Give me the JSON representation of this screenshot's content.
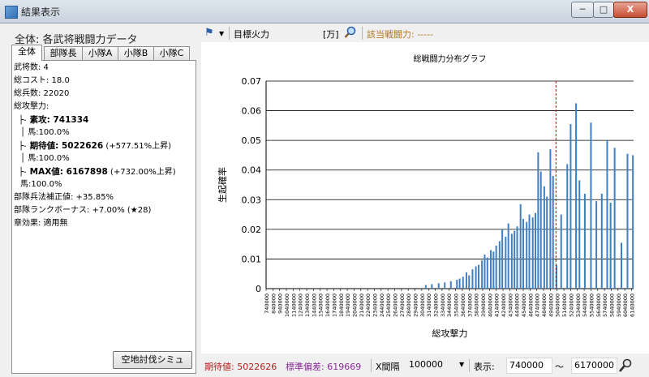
{
  "window": {
    "title": "結果表示",
    "min_label": "─",
    "max_label": "□",
    "close_label": "X"
  },
  "left": {
    "heading": "全体: 各武将戦闘力データ",
    "tabs": [
      "全体",
      "部隊長",
      "小隊A",
      "小隊B",
      "小隊C"
    ],
    "lines": [
      {
        "text": "武将数: 4",
        "style": "normal"
      },
      {
        "text": "総コスト: 18.0",
        "style": "normal"
      },
      {
        "text": "総兵数: 22020",
        "style": "normal"
      },
      {
        "text": "総攻撃力:",
        "style": "normal"
      },
      {
        "prefix": "├-",
        "bold": "素攻: 741334",
        "rest": "",
        "style": "tree"
      },
      {
        "text": "│ 馬:100.0%",
        "style": "indent"
      },
      {
        "prefix": "├-",
        "bold": "期待値: 5022626",
        "rest": " (+577.51%上昇)",
        "style": "tree"
      },
      {
        "text": "│ 馬:100.0%",
        "style": "indent"
      },
      {
        "prefix": "├-",
        "bold": "MAX値: 6167898",
        "rest": " (+732.00%上昇)",
        "style": "tree"
      },
      {
        "text": "   馬:100.0%",
        "style": "indent"
      },
      {
        "text": "部隊兵法補正値: +35.85%",
        "style": "normal"
      },
      {
        "text": "部隊ランクボーナス: +7.00% (★28)",
        "style": "normal"
      },
      {
        "text": "章効果: 適用無",
        "style": "normal"
      }
    ],
    "sim_button": "空地討伐シミュ"
  },
  "toolbar": {
    "target_label": "目標火力",
    "target_value": "",
    "unit_label": "[万]",
    "hit_label": "該当戦闘力: -----"
  },
  "chart_data": {
    "type": "bar",
    "title": "総戦闘力分布グラフ",
    "xlabel": "総攻撃力",
    "ylabel": "生起確率",
    "ylim": [
      0,
      0.07
    ],
    "yticks": [
      0,
      0.01,
      0.02,
      0.03,
      0.04,
      0.05,
      0.06,
      0.07
    ],
    "xlim": [
      740000,
      6170000
    ],
    "xticks": [
      740000,
      840000,
      940000,
      1040000,
      1140000,
      1240000,
      1340000,
      1440000,
      1540000,
      1640000,
      1740000,
      1840000,
      1940000,
      2040000,
      2140000,
      2240000,
      2340000,
      2440000,
      2540000,
      2640000,
      2740000,
      2840000,
      2940000,
      3040000,
      3140000,
      3240000,
      3340000,
      3440000,
      3540000,
      3640000,
      3740000,
      3840000,
      3940000,
      4040000,
      4140000,
      4240000,
      4340000,
      4440000,
      4540000,
      4640000,
      4740000,
      4840000,
      4940000,
      5040000,
      5140000,
      5240000,
      5340000,
      5440000,
      5540000,
      5640000,
      5740000,
      5840000,
      5940000,
      6040000,
      6140000
    ],
    "expected_line": 5022626,
    "grid": true,
    "color": "#3f7fc3",
    "marker_color": "#c00000",
    "x": [
      3100000,
      3190000,
      3290000,
      3380000,
      3470000,
      3560000,
      3600000,
      3650000,
      3700000,
      3740000,
      3790000,
      3840000,
      3880000,
      3930000,
      3970000,
      4010000,
      4060000,
      4100000,
      4140000,
      4190000,
      4230000,
      4280000,
      4320000,
      4370000,
      4410000,
      4450000,
      4500000,
      4540000,
      4590000,
      4630000,
      4680000,
      4720000,
      4760000,
      4800000,
      4850000,
      4890000,
      4940000,
      4980000,
      5030000,
      5100000,
      5190000,
      5240000,
      5320000,
      5370000,
      5450000,
      5540000,
      5620000,
      5700000,
      5780000,
      5830000,
      5890000,
      5990000,
      6080000,
      6160000
    ],
    "values": [
      0.0012,
      0.0015,
      0.0018,
      0.0021,
      0.0025,
      0.003,
      0.0034,
      0.004,
      0.0055,
      0.0045,
      0.0065,
      0.0075,
      0.008,
      0.0095,
      0.0115,
      0.0105,
      0.013,
      0.0125,
      0.0145,
      0.016,
      0.02,
      0.0175,
      0.022,
      0.0185,
      0.0195,
      0.021,
      0.0285,
      0.0235,
      0.0225,
      0.025,
      0.024,
      0.0255,
      0.046,
      0.0395,
      0.0345,
      0.031,
      0.047,
      0.038,
      0.008,
      0.025,
      0.042,
      0.0555,
      0.0625,
      0.0365,
      0.032,
      0.056,
      0.0295,
      0.032,
      0.05,
      0.029,
      0.0475,
      0.0155,
      0.0455,
      0.045
    ]
  },
  "status": {
    "expected_label": "期待値: 5022626",
    "stddev_label": "標準偏差: 619669",
    "interval_label": "X間隔",
    "interval_value": "100000",
    "display_label": "表示:",
    "range_from": "740000",
    "range_sep": "〜",
    "range_to": "6170000"
  }
}
